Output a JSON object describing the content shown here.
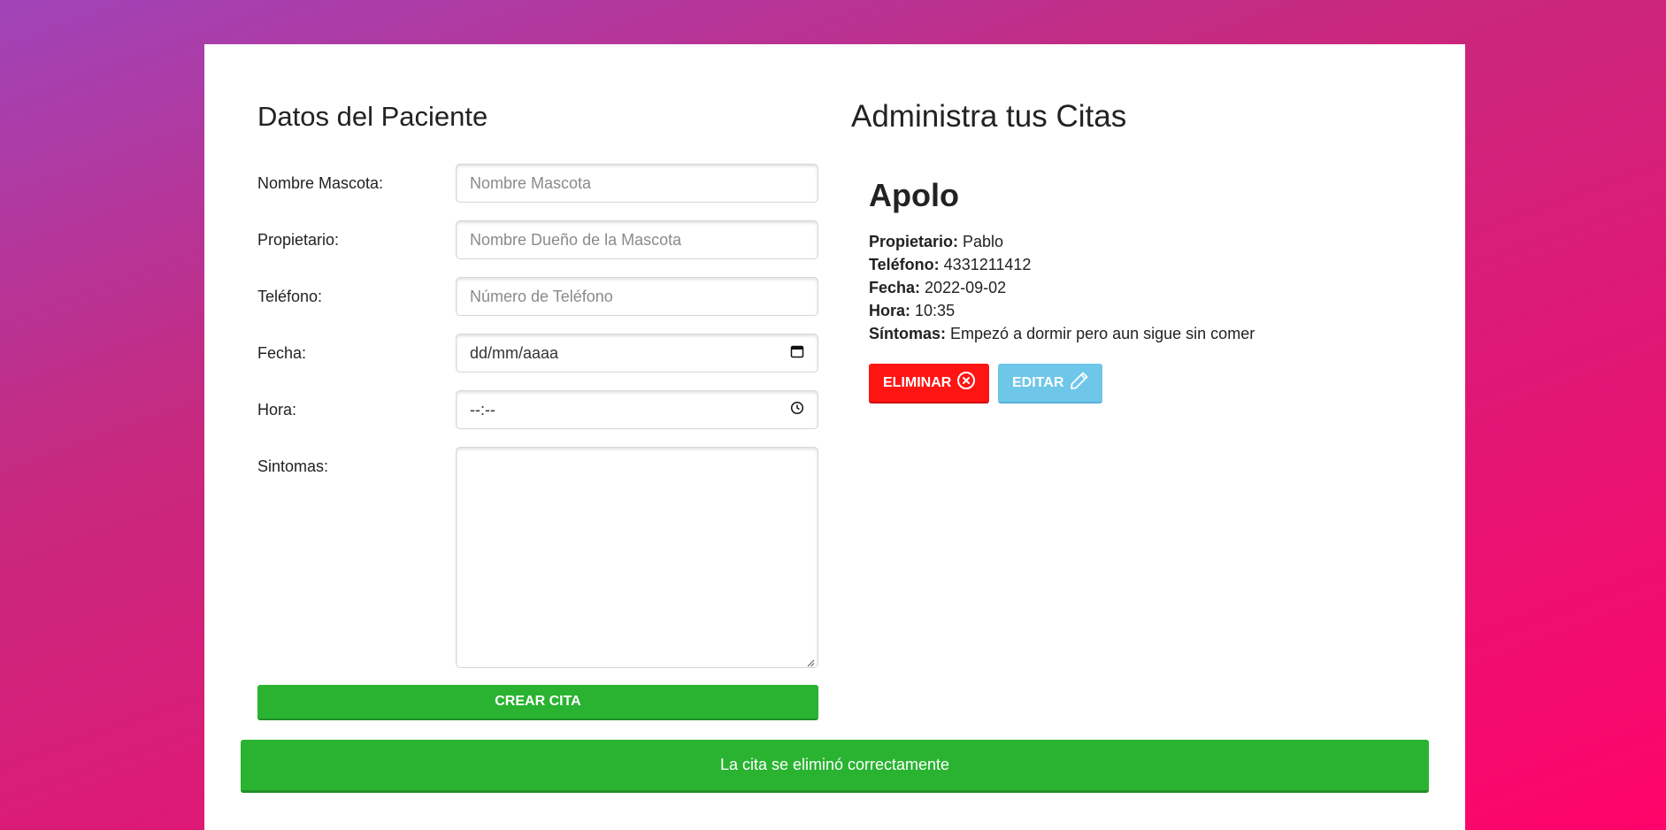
{
  "form": {
    "title": "Datos del Paciente",
    "pet_name": {
      "label": "Nombre Mascota:",
      "placeholder": "Nombre Mascota"
    },
    "owner": {
      "label": "Propietario:",
      "placeholder": "Nombre Dueño de la Mascota"
    },
    "phone": {
      "label": "Teléfono:",
      "placeholder": "Número de Teléfono"
    },
    "date": {
      "label": "Fecha:",
      "placeholder": "dd/mm/aaaa",
      "icon": "calendar-icon"
    },
    "time": {
      "label": "Hora:",
      "placeholder": "--:--",
      "icon": "clock-icon"
    },
    "symptoms": {
      "label": "Sintomas:"
    },
    "submit_label": "CREAR CITA"
  },
  "list": {
    "title": "Administra tus Citas",
    "appointments": [
      {
        "name": "Apolo",
        "owner_label": "Propietario:",
        "owner": "Pablo",
        "phone_label": "Teléfono:",
        "phone": "4331211412",
        "date_label": "Fecha:",
        "date": "2022-09-02",
        "time_label": "Hora:",
        "time": "10:35",
        "symptoms_label": "Síntomas:",
        "symptoms": "Empezó a dormir pero aun sigue sin comer",
        "delete_label": "ELIMINAR",
        "edit_label": "EDITAR"
      }
    ]
  },
  "alert": {
    "message": "La cita se eliminó correctamente"
  },
  "colors": {
    "success": "#29b331",
    "danger": "#ff1414",
    "info": "#6ec6e8",
    "background_start": "#a044b8",
    "background_end": "#ff046a"
  }
}
